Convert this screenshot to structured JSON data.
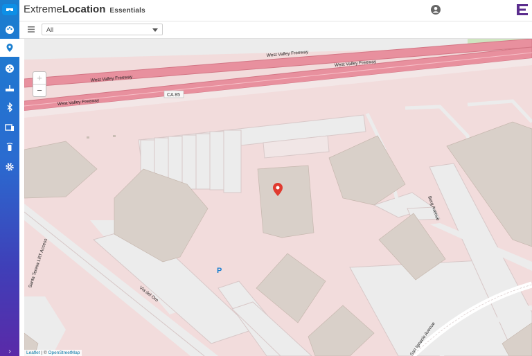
{
  "header": {
    "brand_light": "Extreme",
    "brand_bold": "Location",
    "brand_sub": "Essentials"
  },
  "toolbar": {
    "filter_value": "All"
  },
  "sidebar": {
    "items": [
      {
        "name": "logo-icon"
      },
      {
        "name": "palette-icon"
      },
      {
        "name": "location-icon",
        "active": true
      },
      {
        "name": "dashboard-icon"
      },
      {
        "name": "router-icon"
      },
      {
        "name": "bluetooth-icon"
      },
      {
        "name": "devices-icon"
      },
      {
        "name": "beacon-icon"
      },
      {
        "name": "settings-icon"
      }
    ],
    "expand_glyph": "›"
  },
  "map": {
    "zoom_in": "+",
    "zoom_out": "−",
    "roads": {
      "freeway_1": "West Valley Freeway",
      "freeway_2": "West Valley Freeway",
      "freeway_3": "West Valley Freeway",
      "freeway_4": "West Valley Freeway",
      "ca85": "CA 85",
      "light_rail": "Santa Teresa LRT Access",
      "via_del_oro": "Via del Oro",
      "berg": "Berg Avenue",
      "san_ignacio": "San Ignacio Avenue"
    },
    "parking": "P",
    "attribution_leaflet": "Leaflet",
    "attribution_sep": " | © ",
    "attribution_osm": "OpenStreetMap"
  },
  "colors": {
    "accent": "#1a7fd0",
    "freeway": "#e8909e",
    "building": "#d9d0c9",
    "land": "#f2dcdc",
    "marker": "#e03a2f"
  }
}
